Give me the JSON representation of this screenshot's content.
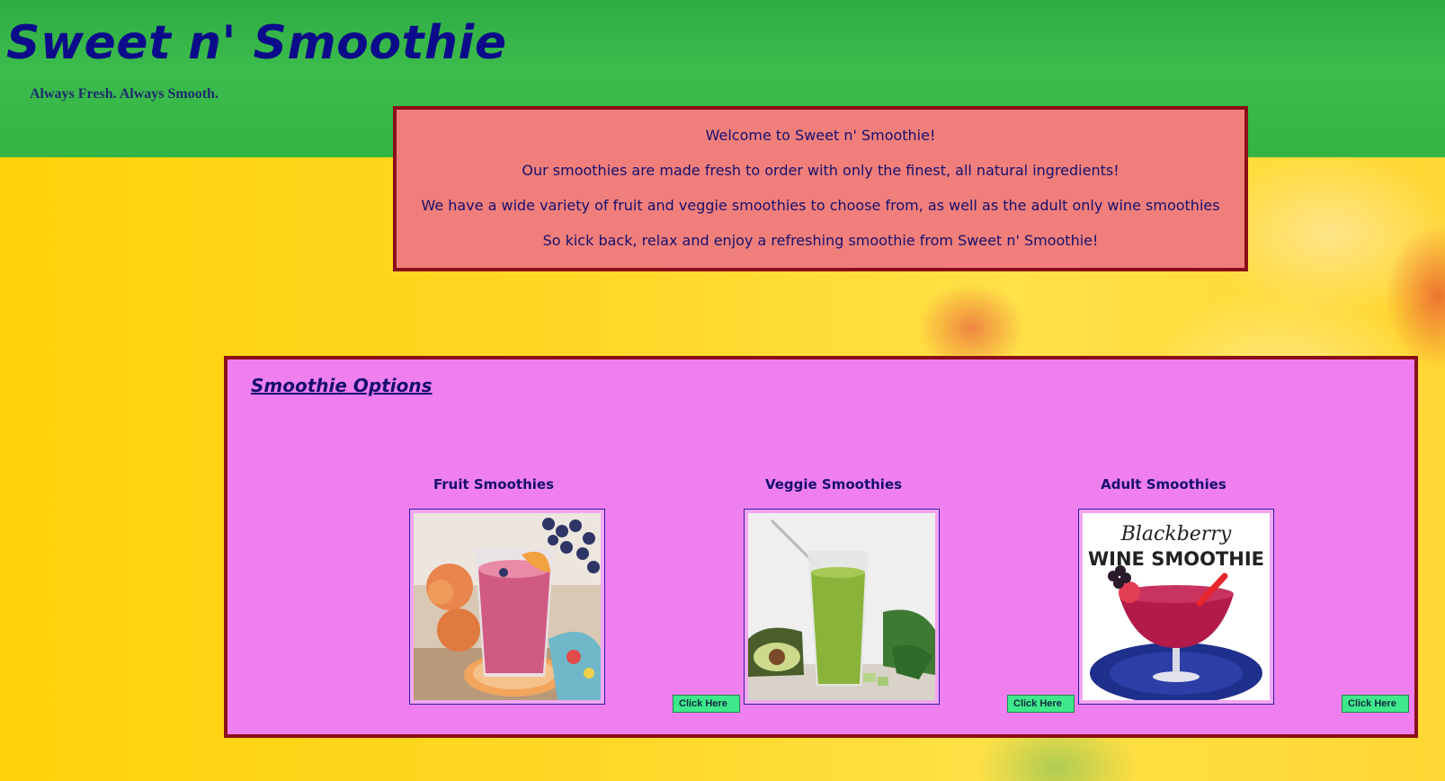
{
  "header": {
    "title": "Sweet n' Smoothie",
    "tagline": "Always Fresh. Always Smooth."
  },
  "welcome": {
    "lines": [
      "Welcome to Sweet n' Smoothie!",
      "Our smoothies are made fresh to order with only the finest, all natural ingredients!",
      "We have a wide variety of fruit and veggie smoothies to choose from, as well as the adult only wine smoothies",
      "So kick back, relax and enjoy a refreshing smoothie from Sweet n' Smoothie!"
    ]
  },
  "options": {
    "title": "Smoothie Options",
    "categories": [
      {
        "title": "Fruit Smoothies",
        "button": "Click Here"
      },
      {
        "title": "Veggie Smoothies",
        "button": "Click Here"
      },
      {
        "title": "Adult Smoothies",
        "button": "Click Here",
        "image_text_line1": "Blackberry",
        "image_text_line2": "WINE SMOOTHIE"
      }
    ]
  },
  "colors": {
    "header_green": "#33b443",
    "title_navy": "#0c0c8a",
    "welcome_bg": "#f07f7b",
    "options_bg": "#ef7fef",
    "border_maroon": "#8a0f18",
    "button_green": "#3fe88a",
    "page_yellow": "#ffd92a"
  }
}
